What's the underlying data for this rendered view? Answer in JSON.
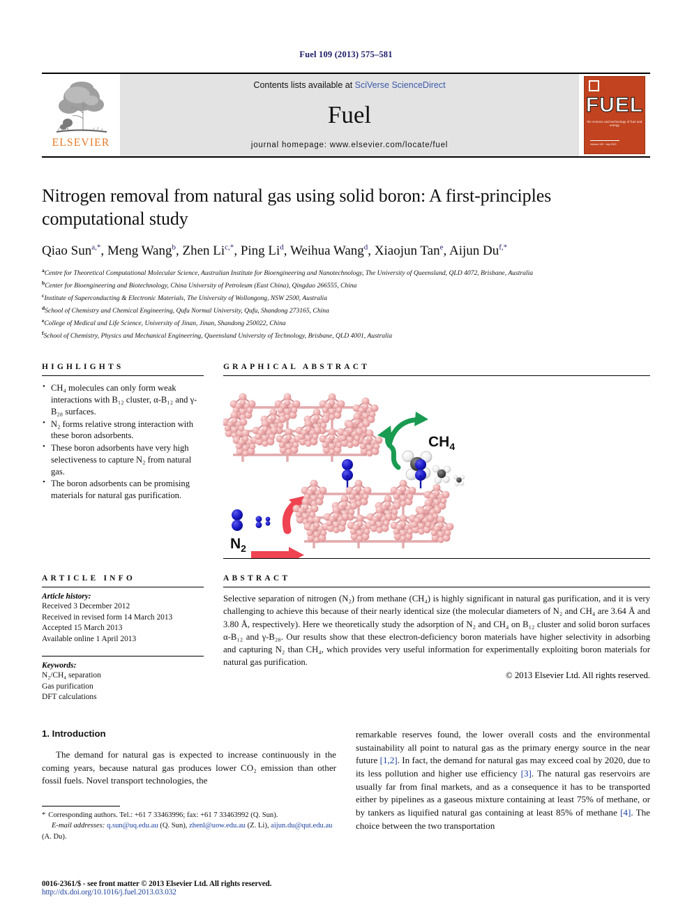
{
  "running_head": "Fuel 109 (2013) 575–581",
  "masthead": {
    "contents_prefix": "Contents lists available at ",
    "sciencedirect": "SciVerse ScienceDirect",
    "journal_name": "Fuel",
    "homepage": "journal homepage: www.elsevier.com/locate/fuel",
    "publisher_word": "ELSEVIER",
    "cover_title": "FUEL",
    "cover_subtitle": "the science and technology of fuel and energy",
    "cover_footer": "Volume 109 · July 2013"
  },
  "article": {
    "title": "Nitrogen removal from natural gas using solid boron: A first-principles computational study",
    "authors": [
      {
        "name": "Qiao Sun",
        "sup": "a,*"
      },
      {
        "name": "Meng Wang",
        "sup": "b"
      },
      {
        "name": "Zhen Li",
        "sup": "c,*"
      },
      {
        "name": "Ping Li",
        "sup": "d"
      },
      {
        "name": "Weihua Wang",
        "sup": "d"
      },
      {
        "name": "Xiaojun Tan",
        "sup": "e"
      },
      {
        "name": "Aijun Du",
        "sup": "f,*"
      }
    ],
    "affiliations": [
      {
        "marker": "a",
        "text": "Centre for Theoretical Computational Molecular Science, Australian Institute for Bioengineering and Nanotechnology, The University of Queensland, QLD 4072, Brisbane, Australia"
      },
      {
        "marker": "b",
        "text": "Center for Bioengineering and Biotechnology, China University of Petroleum (East China), Qingdao 266555, China"
      },
      {
        "marker": "c",
        "text": "Institute of Superconducting & Electronic Materials, The University of Wollongong, NSW 2500, Australia"
      },
      {
        "marker": "d",
        "text": "School of Chemistry and Chemical Engineering, Qufu Normal University, Qufu, Shandong 273165, China"
      },
      {
        "marker": "e",
        "text": "College of Medical and Life Science, University of Jinan, Jinan, Shandong 250022, China"
      },
      {
        "marker": "f",
        "text": "School of Chemistry, Physics and Mechanical Engineering, Queensland University of Technology, Brisbane, QLD 4001, Australia"
      }
    ]
  },
  "highlights": {
    "heading": "HIGHLIGHTS",
    "items": [
      "CH₄ molecules can only form weak interactions with B₁₂ cluster, α-B₁₂ and γ-B₂₈ surfaces.",
      "N₂ forms relative strong interaction with these boron adsorbents.",
      "These boron adsorbents have very high selectiveness to capture N₂ from natural gas.",
      "The boron adsorbents can be promising materials for natural gas purification."
    ]
  },
  "graphical_abstract": {
    "heading": "GRAPHICAL ABSTRACT",
    "label_ch4": "CH4",
    "label_ch4_sub": "4",
    "label_n2": "N2",
    "label_n2_sub": "2",
    "colors": {
      "boron": "#edadad",
      "boron_dark": "#d98f92",
      "nitrogen": "#1414c8",
      "carbon": "#4d4d4d",
      "hydrogen": "#f2f2f2",
      "arrow_green": "#1a9b52",
      "arrow_red": "#ef4352"
    }
  },
  "article_info": {
    "heading": "ARTICLE INFO",
    "history_label": "Article history:",
    "history": [
      "Received 3 December 2012",
      "Received in revised form 14 March 2013",
      "Accepted 15 March 2013",
      "Available online 1 April 2013"
    ],
    "keywords_label": "Keywords:",
    "keywords": [
      "N₂/CH₄ separation",
      "Gas purification",
      "DFT calculations"
    ]
  },
  "abstract": {
    "heading": "ABSTRACT",
    "text": "Selective separation of nitrogen (N₂) from methane (CH₄) is highly significant in natural gas purification, and it is very challenging to achieve this because of their nearly identical size (the molecular diameters of N₂ and CH₄ are 3.64 Å and 3.80 Å, respectively). Here we theoretically study the adsorption of N₂ and CH₄ on B₁₂ cluster and solid boron surfaces α-B₁₂ and γ-B₂₈. Our results show that these electron-deficiency boron materials have higher selectivity in adsorbing and capturing N₂ than CH₄, which provides very useful information for experimentally exploiting boron materials for natural gas purification.",
    "copyright": "© 2013 Elsevier Ltd. All rights reserved."
  },
  "body": {
    "section_title": "1. Introduction",
    "left_paragraph": "The demand for natural gas is expected to increase continuously in the coming years, because natural gas produces lower CO₂ emission than other fossil fuels. Novel transport technologies, the",
    "right_paragraph_parts": [
      "remarkable reserves found, the lower overall costs and the environmental sustainability all point to natural gas as the primary energy source in the near future ",
      "[1,2]",
      ". In fact, the demand for natural gas may exceed coal by 2020, due to its less pollution and higher use efficiency ",
      "[3]",
      ". The natural gas reservoirs are usually far from final markets, and as a consequence it has to be transported either by pipelines as a gaseous mixture containing at least 75% of methane, or by tankers as liquified natural gas containing at least 85% of methane ",
      "[4]",
      ". The choice between the two transportation"
    ]
  },
  "footnote": {
    "star": "*",
    "corresponding": "Corresponding authors. Tel.: +61 7 33463996; fax: +61 7 33463992 (Q. Sun).",
    "email_label": "E-mail addresses:",
    "emails": [
      {
        "address": "q.sun@uq.edu.au",
        "who": " (Q. Sun), "
      },
      {
        "address": "zhenl@uow.edu.au",
        "who": " (Z. Li), "
      },
      {
        "address": "aijun.du@qut.edu.au",
        "who": " (A. Du)."
      }
    ]
  },
  "footer": {
    "issn_line": "0016-2361/$ - see front matter © 2013 Elsevier Ltd. All rights reserved.",
    "doi_line": "http://dx.doi.org/10.1016/j.fuel.2013.03.032"
  }
}
